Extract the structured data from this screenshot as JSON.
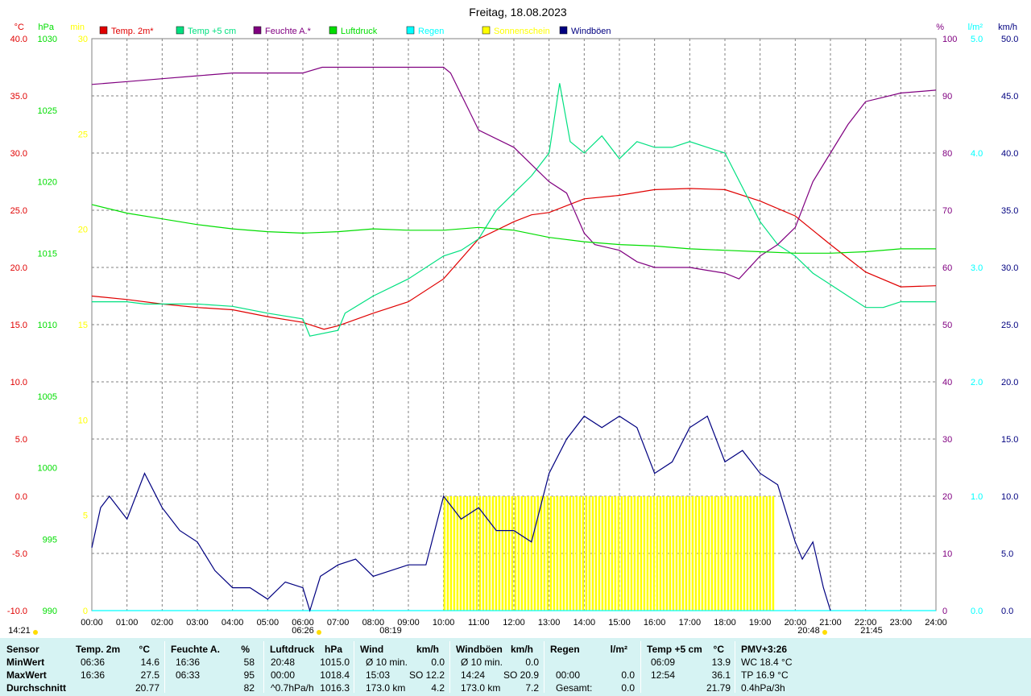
{
  "title": "Freitag, 18.08.2023",
  "colors": {
    "temp2m": "#e00000",
    "temp5cm": "#00e080",
    "humidity": "#800080",
    "pressure": "#00dd00",
    "rain": "#00ffff",
    "sun": "#ffff00",
    "wind": "#000080",
    "grid": "#808080",
    "table_bg": "#d6f3f3"
  },
  "axes": {
    "left": [
      {
        "unit": "°C",
        "color": "#e00000",
        "ticks": [
          "40.0",
          "35.0",
          "30.0",
          "25.0",
          "20.0",
          "15.0",
          "10.0",
          "5.0",
          "0.0",
          "-5.0",
          "-10.0"
        ]
      },
      {
        "unit": "hPa",
        "color": "#00dd00",
        "ticks": [
          "1030",
          "1025",
          "1020",
          "1015",
          "1010",
          "1005",
          "1000",
          "995",
          "990"
        ]
      },
      {
        "unit": "min",
        "color": "#ffff00",
        "ticks": [
          "30",
          "25",
          "20",
          "15",
          "10",
          "5",
          "0"
        ]
      }
    ],
    "right": [
      {
        "unit": "%",
        "color": "#800080",
        "ticks": [
          "100",
          "90",
          "80",
          "70",
          "60",
          "50",
          "40",
          "30",
          "20",
          "10",
          "0"
        ]
      },
      {
        "unit": "l/m²",
        "color": "#00ffff",
        "ticks": [
          "5.0",
          "4.0",
          "3.0",
          "2.0",
          "1.0",
          "0.0"
        ]
      },
      {
        "unit": "km/h",
        "color": "#000080",
        "ticks": [
          "50.0",
          "45.0",
          "40.0",
          "35.0",
          "30.0",
          "25.0",
          "20.0",
          "15.0",
          "10.0",
          "5.0",
          "0.0"
        ]
      }
    ]
  },
  "chart_data": {
    "type": "line",
    "title": "Freitag, 18.08.2023",
    "x_labels": [
      "00:00",
      "01:00",
      "02:00",
      "03:00",
      "04:00",
      "05:00",
      "06:00",
      "07:00",
      "08:00",
      "09:00",
      "10:00",
      "11:00",
      "12:00",
      "13:00",
      "14:00",
      "15:00",
      "16:00",
      "17:00",
      "18:00",
      "19:00",
      "20:00",
      "21:00",
      "22:00",
      "23:00",
      "24:00"
    ],
    "markers": [
      {
        "label": "14:21",
        "time": "14:21",
        "side": "left"
      },
      {
        "label": "06:26",
        "time": "06:26"
      },
      {
        "label": "08:19",
        "time": "08:19"
      },
      {
        "label": "20:48",
        "time": "20:48"
      },
      {
        "label": "21:45",
        "time": "21:45"
      }
    ],
    "series": [
      {
        "name": "Temp. 2m*",
        "unit": "°C",
        "color": "#e00000",
        "hours": [
          0,
          1,
          2,
          3,
          4,
          5,
          6,
          6.6,
          7,
          8,
          9,
          10,
          11,
          12,
          12.5,
          13,
          14,
          15,
          16,
          17,
          18,
          19,
          20,
          21,
          22,
          23,
          24
        ],
        "values": [
          17.5,
          17.2,
          16.8,
          16.5,
          16.3,
          15.7,
          15.2,
          14.6,
          14.9,
          16.0,
          17.0,
          19.0,
          22.5,
          24.0,
          24.6,
          24.8,
          26.0,
          26.3,
          26.8,
          26.9,
          26.8,
          25.8,
          24.5,
          22.0,
          19.6,
          18.3,
          18.4
        ]
      },
      {
        "name": "Temp +5 cm",
        "unit": "°C",
        "color": "#00e080",
        "hours": [
          0,
          1,
          1.5,
          2,
          3,
          4,
          5,
          6,
          6.2,
          7,
          7.2,
          8,
          9,
          10,
          10.5,
          11,
          11.5,
          12,
          12.5,
          13,
          13.3,
          13.6,
          14,
          14.5,
          15,
          15.5,
          16,
          16.5,
          17,
          17.5,
          18,
          18.5,
          19,
          19.5,
          20,
          20.5,
          21,
          21.5,
          22,
          22.5,
          23,
          24
        ],
        "values": [
          17.0,
          17.0,
          16.8,
          16.8,
          16.8,
          16.6,
          16.0,
          15.5,
          14.0,
          14.5,
          16.0,
          17.5,
          19.0,
          21.0,
          21.5,
          22.5,
          25.0,
          26.5,
          28.0,
          30.0,
          36.1,
          31.0,
          30.0,
          31.5,
          29.5,
          31.0,
          30.5,
          30.5,
          31.0,
          30.5,
          30.0,
          27.0,
          24.0,
          22.0,
          21.0,
          19.5,
          18.5,
          17.5,
          16.5,
          16.5,
          17.0,
          17.0
        ]
      },
      {
        "name": "Feuchte A.*",
        "unit": "%",
        "color": "#800080",
        "hours": [
          0,
          1,
          2,
          3,
          4,
          5,
          6,
          6.55,
          7,
          8,
          9,
          10,
          10.2,
          11,
          12,
          12.5,
          13,
          13.5,
          14,
          14.3,
          15,
          15.5,
          16,
          17,
          17.5,
          18,
          18.4,
          19,
          19.5,
          20,
          20.5,
          21,
          21.5,
          22,
          23,
          24
        ],
        "values": [
          92,
          92.5,
          93,
          93.5,
          94,
          94,
          94,
          95,
          95,
          95,
          95,
          95,
          94,
          84,
          81,
          78,
          75,
          73,
          66,
          64,
          63,
          61,
          60,
          60,
          59.5,
          59,
          58,
          62,
          64,
          67,
          75,
          80,
          85,
          89,
          90.5,
          91
        ]
      },
      {
        "name": "Luftdruck",
        "unit": "hPa",
        "color": "#00dd00",
        "hours": [
          0,
          1,
          2,
          3,
          4,
          5,
          6,
          7,
          8,
          9,
          10,
          11,
          12,
          13,
          14,
          15,
          16,
          17,
          18,
          19,
          20,
          21,
          22,
          23,
          24
        ],
        "values": [
          1018.4,
          1017.8,
          1017.4,
          1017.0,
          1016.7,
          1016.5,
          1016.4,
          1016.5,
          1016.7,
          1016.6,
          1016.6,
          1016.8,
          1016.6,
          1016.1,
          1015.8,
          1015.6,
          1015.5,
          1015.3,
          1015.2,
          1015.1,
          1015.0,
          1015.0,
          1015.1,
          1015.3,
          1015.3
        ]
      },
      {
        "name": "Regen",
        "unit": "l/m²",
        "color": "#00ffff",
        "hours": [
          0,
          24
        ],
        "values": [
          0,
          0
        ]
      },
      {
        "name": "Sonnenschein",
        "unit": "min",
        "color": "#ffff00",
        "hours": [
          9.9,
          10.0,
          10.5,
          11.0,
          11.5,
          12.0,
          12.5,
          13.0,
          13.5,
          14.0,
          14.5,
          15.0,
          15.5,
          16.0,
          16.5,
          17.0,
          17.5,
          18.0,
          18.5,
          19.0,
          19.3,
          19.4
        ],
        "values": [
          0,
          6,
          6,
          6,
          6,
          6,
          6,
          6,
          6,
          6,
          6,
          6,
          6,
          6,
          6,
          6,
          6,
          6,
          6,
          6,
          6,
          0
        ]
      },
      {
        "name": "Windböen",
        "unit": "km/h",
        "color": "#000080",
        "hours": [
          0,
          0.25,
          0.5,
          1,
          1.5,
          2,
          2.5,
          3,
          3.5,
          4,
          4.5,
          5,
          5.5,
          6,
          6.2,
          6.5,
          7,
          7.5,
          8,
          8.5,
          9,
          9.5,
          10,
          10.5,
          11,
          11.5,
          12,
          12.5,
          13,
          13.5,
          14,
          14.5,
          15,
          15.5,
          16,
          16.5,
          17,
          17.5,
          18,
          18.5,
          19,
          19.5,
          20,
          20.2,
          20.5,
          20.8,
          21
        ],
        "values": [
          5.5,
          9,
          10,
          8,
          12,
          9,
          7,
          6,
          3.5,
          2,
          2,
          1,
          2.5,
          2,
          0,
          3,
          4,
          4.5,
          3,
          3.5,
          4,
          4,
          10,
          8,
          9,
          7,
          7,
          6,
          12,
          15,
          17,
          16,
          17,
          16,
          12,
          13,
          16,
          17,
          13,
          14,
          12,
          11,
          6,
          4.5,
          6,
          2,
          0
        ]
      }
    ],
    "ylim_temp": [
      -10,
      40
    ],
    "ylim_pressure": [
      990,
      1030
    ],
    "ylim_sun_min": [
      0,
      30
    ],
    "ylim_humidity": [
      0,
      100
    ],
    "ylim_rain": [
      0,
      5
    ],
    "ylim_wind": [
      0,
      50
    ],
    "xlim_hours": [
      0,
      24
    ],
    "grid": true,
    "legend_position": "top"
  },
  "table": {
    "row_labels": [
      "Sensor",
      "MinWert",
      "MaxWert",
      "Durchschnitt"
    ],
    "sections": [
      {
        "header": "Temp. 2m",
        "unit": "°C",
        "rows": [
          [
            "06:36",
            "14.6"
          ],
          [
            "16:36",
            "27.5"
          ],
          [
            "",
            "20.77"
          ]
        ]
      },
      {
        "header": "Feuchte A.",
        "unit": "%",
        "rows": [
          [
            "16:36",
            "58"
          ],
          [
            "06:33",
            "95"
          ],
          [
            "",
            "82"
          ]
        ]
      },
      {
        "header": "Luftdruck",
        "unit": "hPa",
        "rows": [
          [
            "20:48",
            "1015.0"
          ],
          [
            "00:00",
            "1018.4"
          ],
          [
            "^0.7hPa/h",
            "1016.3"
          ]
        ]
      },
      {
        "header": "Wind",
        "unit": "km/h",
        "rows": [
          [
            "Ø 10 min.",
            "0.0"
          ],
          [
            "15:03",
            "SO 12.2"
          ],
          [
            "173.0 km",
            "4.2"
          ]
        ]
      },
      {
        "header": "Windböen",
        "unit": "km/h",
        "rows": [
          [
            "Ø 10 min.",
            "0.0"
          ],
          [
            "14:24",
            "SO 20.9"
          ],
          [
            "173.0 km",
            "7.2"
          ]
        ]
      },
      {
        "header": "Regen",
        "unit": "l/m²",
        "rows": [
          [
            "",
            ""
          ],
          [
            "00:00",
            "0.0"
          ],
          [
            "Gesamt:",
            "0.0"
          ]
        ]
      },
      {
        "header": "Temp +5 cm",
        "unit": "°C",
        "rows": [
          [
            "06:09",
            "13.9"
          ],
          [
            "12:54",
            "36.1"
          ],
          [
            "",
            "21.79"
          ]
        ]
      },
      {
        "header": "PMV+3:26",
        "unit": "",
        "rows": [
          [
            "WC 18.4 °C",
            ""
          ],
          [
            "TP 16.9 °C",
            ""
          ],
          [
            "0.4hPa/3h",
            ""
          ]
        ]
      }
    ]
  }
}
